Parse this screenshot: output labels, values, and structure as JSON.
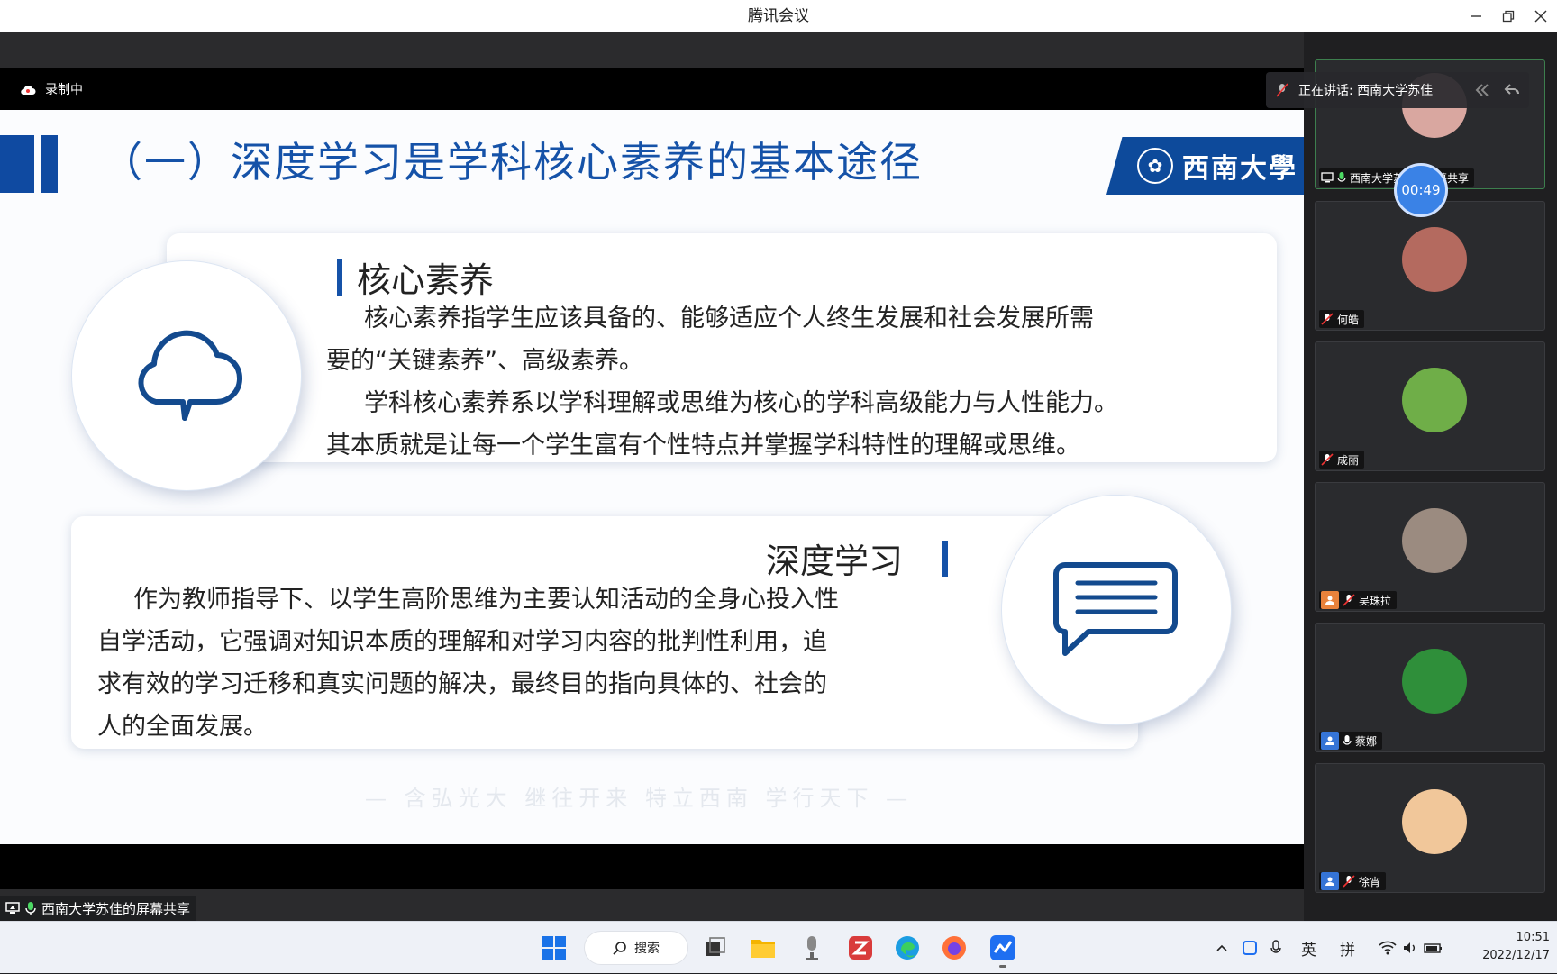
{
  "window": {
    "title": "腾讯会议"
  },
  "recording": {
    "label": "录制中"
  },
  "slide": {
    "heading": "（一）深度学习是学科核心素养的基本途径",
    "logo_text": "西南大學",
    "section1": {
      "title": "核心素养",
      "lines": [
        "核心素养指学生应该具备的、能够适应个人终生发展和社会发展所需",
        "要的“关键素养”、高级素养。",
        "学科核心素养系以学科理解或思维为核心的学科高级能力与人性能力。",
        "其本质就是让每一个学生富有个性特点并掌握学科特性的理解或思维。"
      ]
    },
    "section2": {
      "title": "深度学习",
      "lines": [
        "作为教师指导下、以学生高阶思维为主要认知活动的全身心投入性",
        "自学活动，它强调对知识本质的理解和对学习内容的批判性利用，追",
        "求有效的学习迁移和真实问题的解决，最终目的指向具体的、社会的",
        "人的全面发展。"
      ]
    },
    "motto": "— 含弘光大  继往开来  特立西南  学行天下 —"
  },
  "screen_share": {
    "label": "西南大学苏佳的屏幕共享"
  },
  "speaking": {
    "label": "正在讲话: 西南大学苏佳"
  },
  "timer": {
    "value": "00:49"
  },
  "participants": [
    {
      "name": "西南大学苏佳的屏幕共享",
      "role": "sharer",
      "mic": "on",
      "active": true,
      "avatar_color": "#d9a7a0"
    },
    {
      "name": "何皓",
      "role": "none",
      "mic": "muted",
      "active": false,
      "avatar_color": "#b46a5f"
    },
    {
      "name": "成丽",
      "role": "none",
      "mic": "muted",
      "active": false,
      "avatar_color": "#6fae48"
    },
    {
      "name": "吴珠拉",
      "role": "host",
      "mic": "muted",
      "active": false,
      "avatar_color": "#9b8b80"
    },
    {
      "name": "蔡娜",
      "role": "guest",
      "mic": "on",
      "active": false,
      "avatar_color": "#2f8f3a"
    },
    {
      "name": "徐宵",
      "role": "guest",
      "mic": "muted",
      "active": false,
      "avatar_color": "#f1c79a"
    }
  ],
  "taskbar": {
    "search_label": "搜索",
    "ime_lang": "英",
    "ime_mode": "拼",
    "time": "10:51",
    "date": "2022/12/17"
  },
  "colors": {
    "accent": "#1552a8",
    "brand": "#0d4a9b",
    "active_speaker": "#3d7f4e"
  }
}
